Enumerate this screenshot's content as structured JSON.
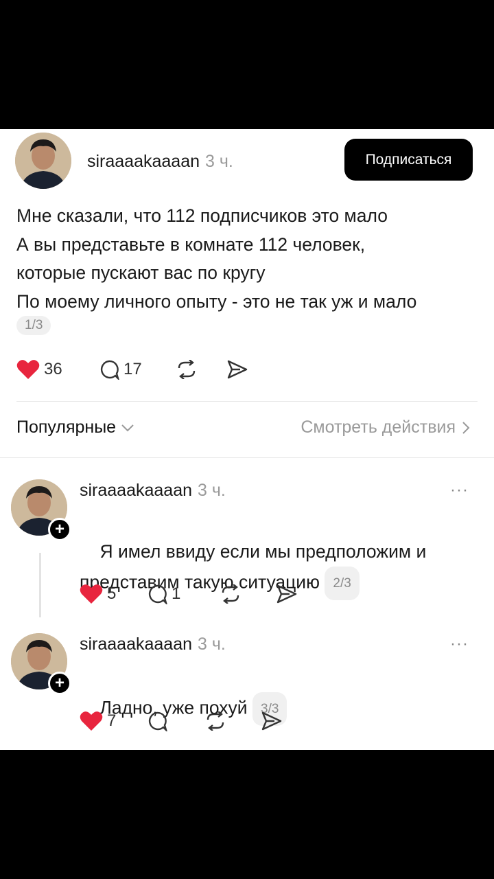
{
  "post": {
    "username": "siraaaakaaaan",
    "time": "3 ч.",
    "follow_label": "Подписаться",
    "text": "Мне сказали, что 112 подписчиков это мало\nА вы представьте в комнате 112 человек,\nкоторые пускают вас по кругу\nПо моему личного опыту - это не так уж и мало",
    "page": "1/3",
    "likes": "36",
    "comments": "17",
    "like_color": "#e8253e"
  },
  "filter": {
    "sort_label": "Популярные",
    "view_label": "Смотреть действия"
  },
  "replies": [
    {
      "username": "siraaaakaaaan",
      "time": "3 ч.",
      "more": "···",
      "text": "Я имел ввиду если мы предположим и\nпредставим такую ситуацию",
      "page": "2/3",
      "likes": "5",
      "comments": "1"
    },
    {
      "username": "siraaaakaaaan",
      "time": "3 ч.",
      "more": "···",
      "text": "Ладно, уже похуй",
      "page": "3/3",
      "likes": "7"
    }
  ]
}
